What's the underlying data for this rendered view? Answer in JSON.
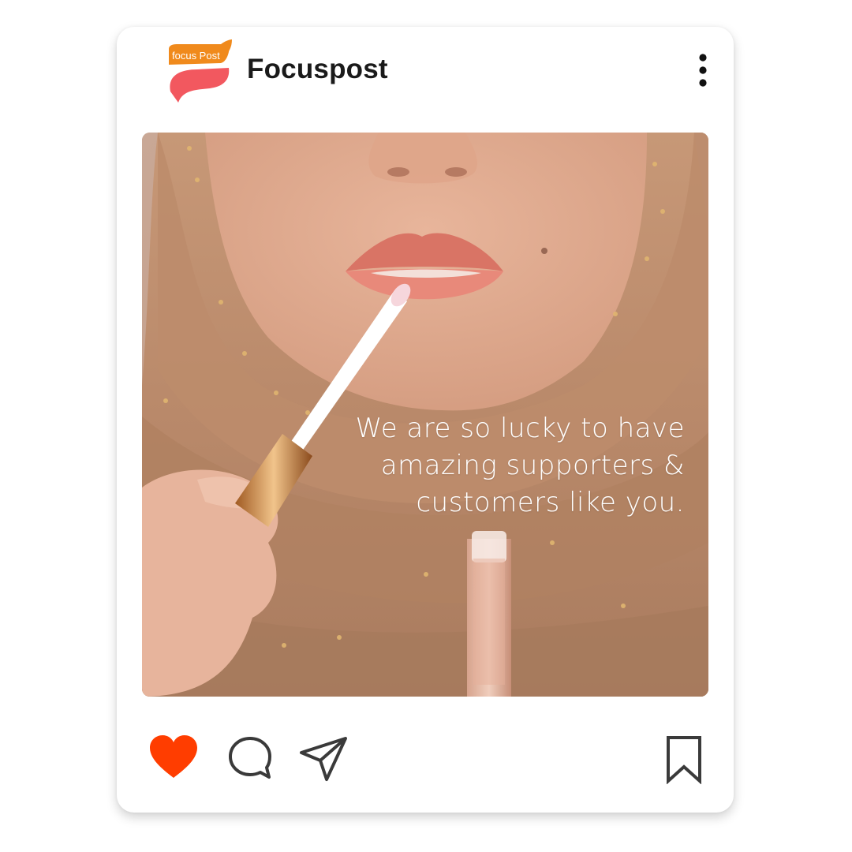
{
  "post": {
    "account_name": "Focuspost",
    "logo_text": "focus Post",
    "caption_lines": [
      "We are so lucky to have",
      "amazing supporters &",
      "customers like you."
    ]
  },
  "icons": {
    "more": "more-vertical-icon",
    "like": "heart-icon",
    "comment": "comment-bubble-icon",
    "share": "send-icon",
    "save": "bookmark-icon"
  },
  "colors": {
    "like_active": "#ff3d00",
    "icon_stroke": "#3a3a3a",
    "logo_orange": "#f08a1c",
    "logo_coral": "#f2585f",
    "text_dark": "#1a1a1a"
  }
}
